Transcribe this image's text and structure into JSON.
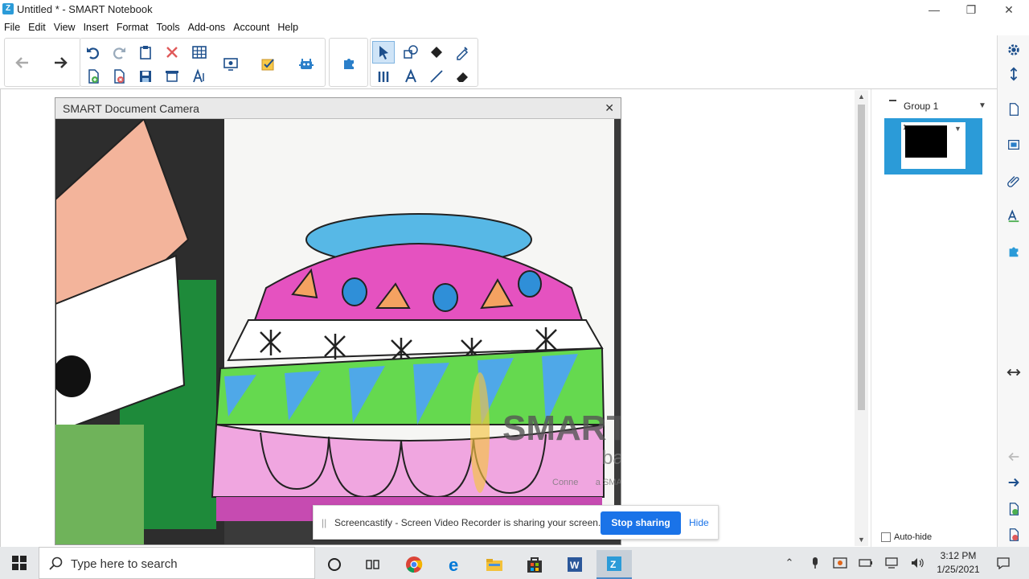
{
  "window": {
    "title": "Untitled * - SMART Notebook",
    "app_icon": "smart-notebook-icon",
    "controls": [
      "minimize-icon",
      "restore-icon",
      "close-icon"
    ]
  },
  "menu": [
    "File",
    "Edit",
    "View",
    "Insert",
    "Format",
    "Tools",
    "Add-ons",
    "Account",
    "Help"
  ],
  "toolbar": {
    "icons": [
      "back-arrow-icon",
      "forward-arrow-icon",
      "undo-icon",
      "redo-icon",
      "paste-icon",
      "delete-icon",
      "table-icon",
      "add-page-icon",
      "delete-page-icon",
      "save-icon",
      "screen-shade-icon",
      "text-format-icon",
      "display-icon",
      "response-icon",
      "gadget-icon",
      "addon-icon",
      "select-icon",
      "shapes-icon",
      "fill-icon",
      "magic-pen-icon",
      "pens-icon",
      "text-icon",
      "line-icon",
      "eraser-icon"
    ],
    "selected_tool": "select-icon"
  },
  "camera_window": {
    "title": "SMART Document Camera",
    "watermark_brand": "SMART",
    "watermark_sub": "basi",
    "watermark_hint": "Conne       a SMAR"
  },
  "share_banner": {
    "grip": "||",
    "message": "Screencastify - Screen Video Recorder is sharing your screen.",
    "stop_label": "Stop sharing",
    "hide_label": "Hide"
  },
  "page_sorter": {
    "group_label": "Group 1",
    "page_number": "1",
    "autohide_label": "Auto-hide",
    "autohide_checked": false
  },
  "side_tabs": [
    "page-sorter-icon",
    "gallery-icon",
    "attachments-icon",
    "properties-icon",
    "addons-icon"
  ],
  "side_controls": [
    "settings-gear-icon",
    "move-toolbar-icon",
    "resize-arrows-icon",
    "prev-page-icon",
    "next-page-icon",
    "add-page-icon",
    "delete-page-icon"
  ],
  "taskbar": {
    "search_placeholder": "Type here to search",
    "apps": [
      "task-view-icon",
      "chrome-icon",
      "edge-icon",
      "file-explorer-icon",
      "store-icon",
      "word-icon",
      "smart-notebook-icon"
    ],
    "time": "3:12 PM",
    "date": "1/25/2021",
    "colors": {
      "accent": "#1a73e8",
      "smart_blue": "#2b9bd8"
    }
  }
}
